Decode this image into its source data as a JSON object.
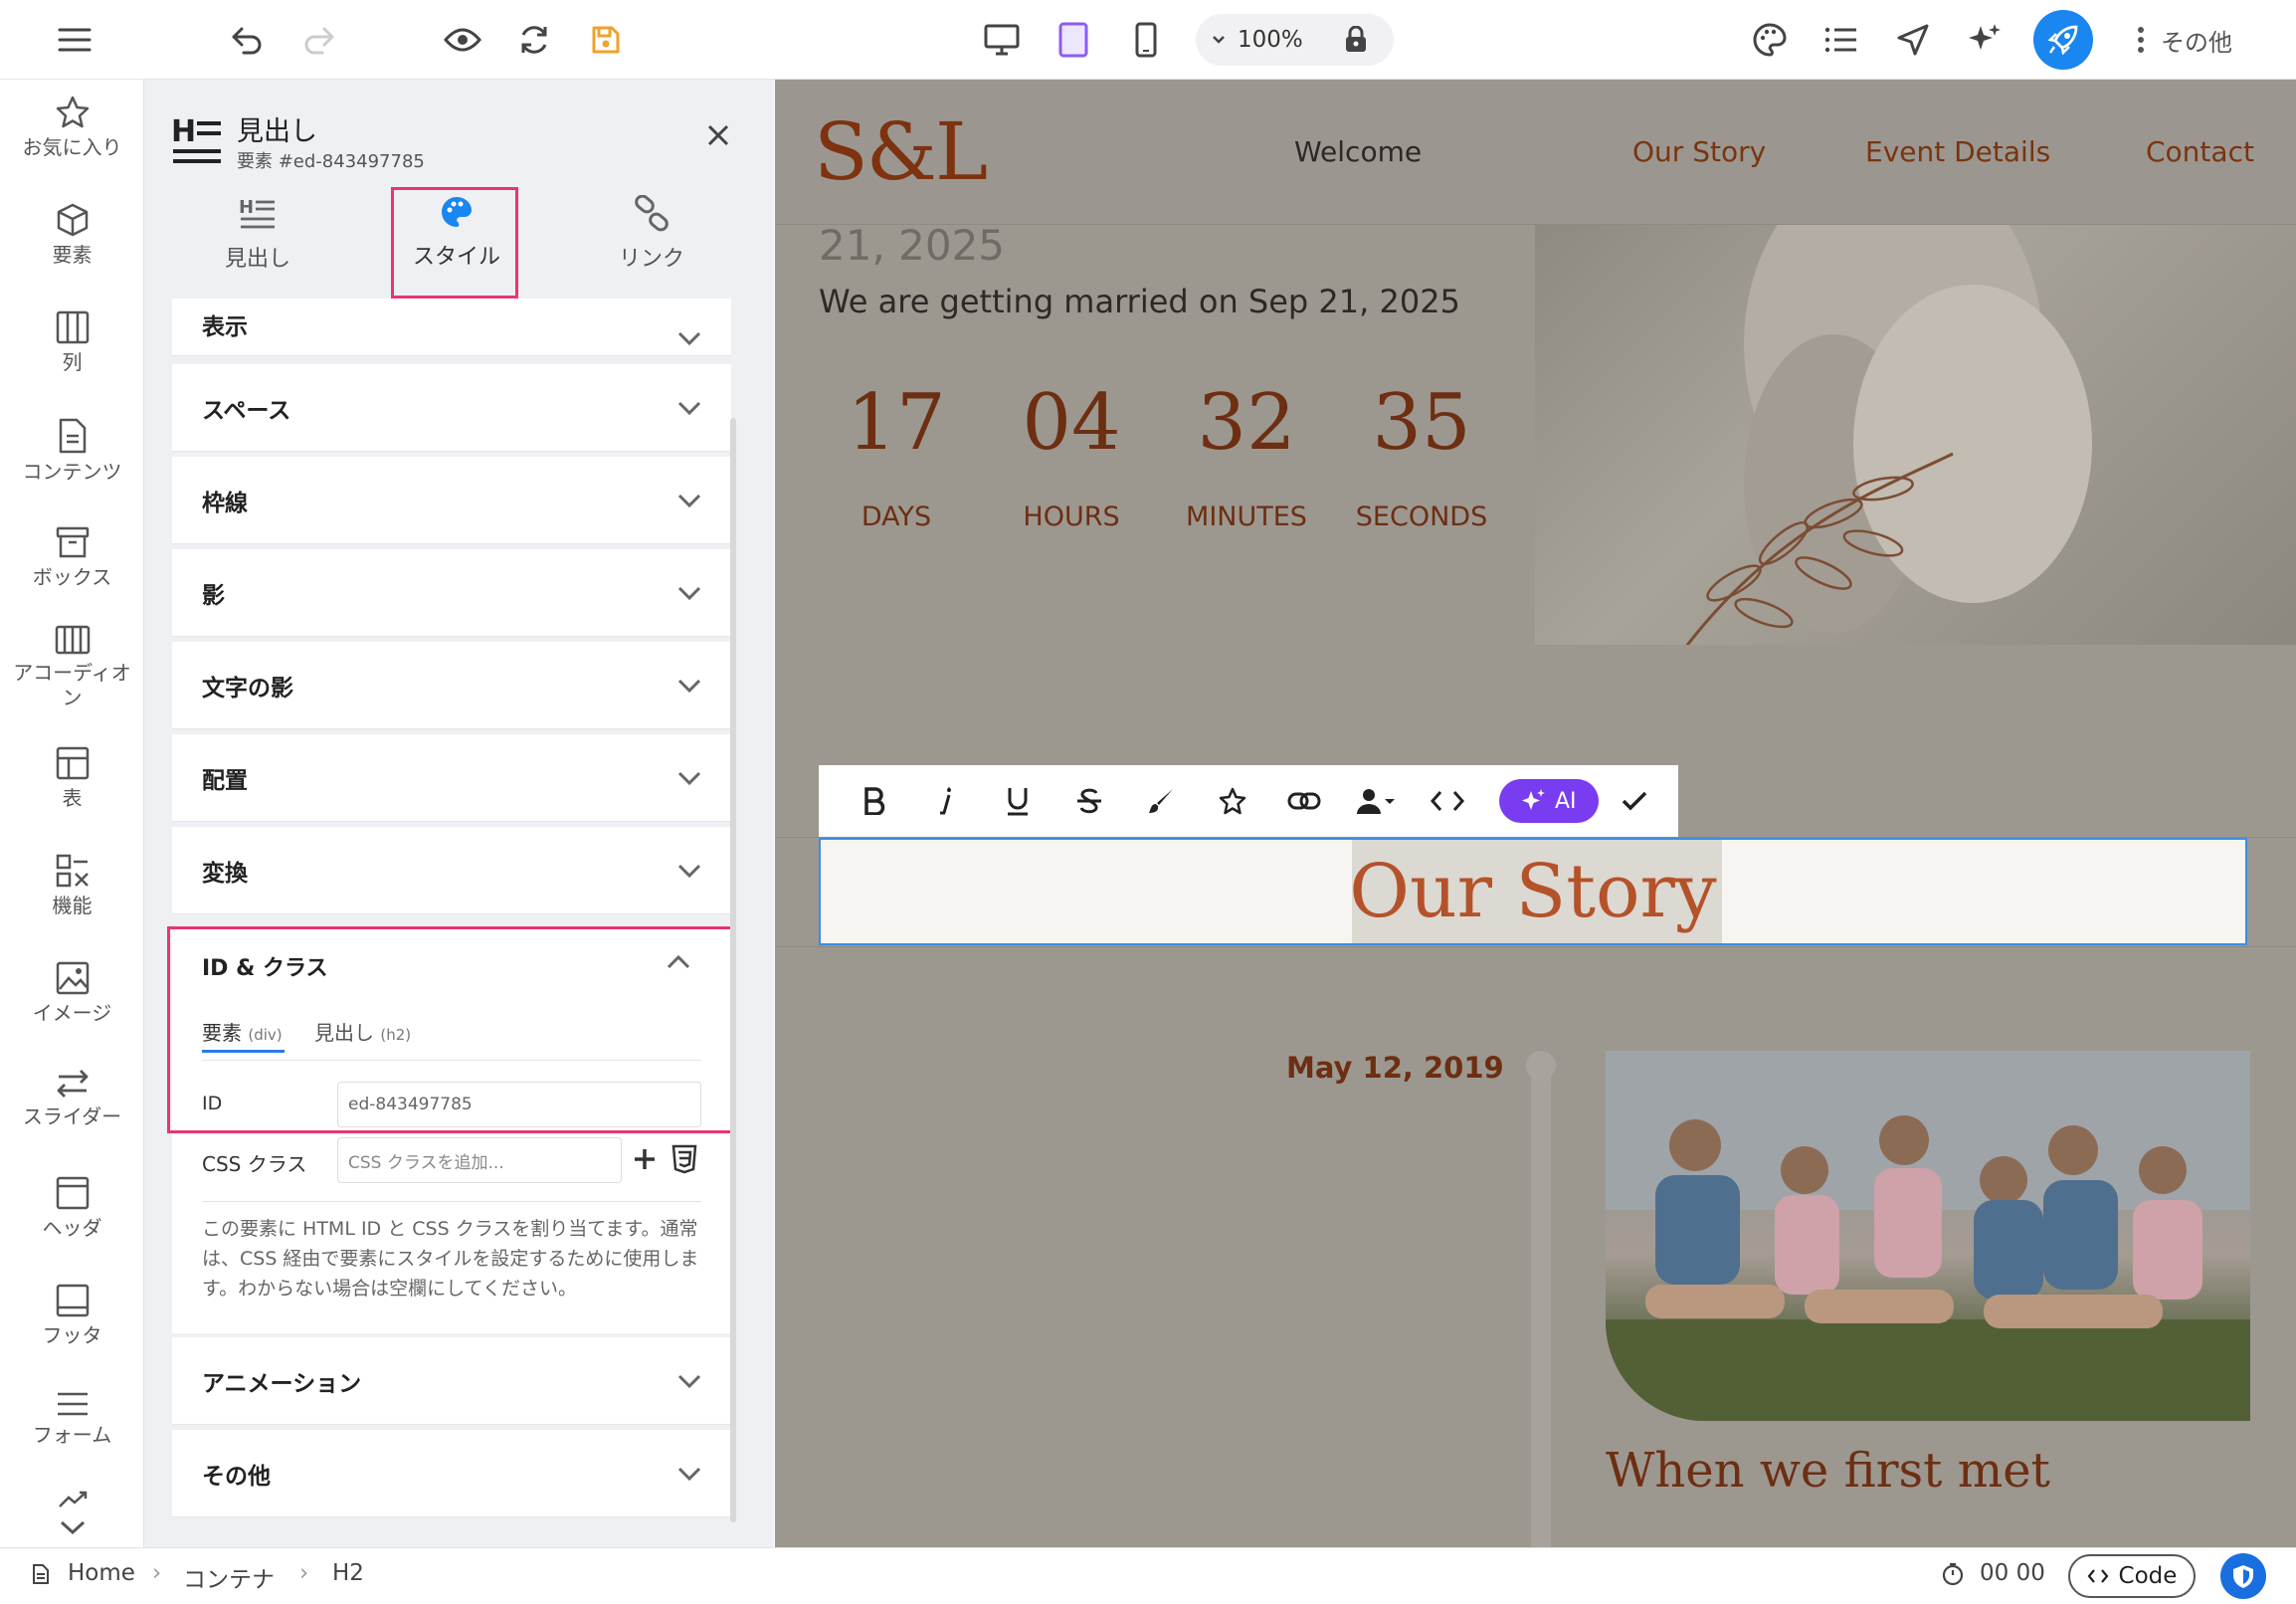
{
  "topbar": {
    "zoom": "100%",
    "more_label": "その他"
  },
  "rail": {
    "items": [
      {
        "label": "お気に入り"
      },
      {
        "label": "要素"
      },
      {
        "label": "列"
      },
      {
        "label": "コンテンツ"
      },
      {
        "label": "ボックス"
      },
      {
        "label": "アコーディオン"
      },
      {
        "label": "表"
      },
      {
        "label": "機能"
      },
      {
        "label": "イメージ"
      },
      {
        "label": "スライダー"
      },
      {
        "label": "ヘッダ"
      },
      {
        "label": "フッタ"
      },
      {
        "label": "フォーム"
      }
    ]
  },
  "panel": {
    "title": "見出し",
    "subtitle": "要素 #ed-843497785",
    "tabs": [
      {
        "label": "見出し"
      },
      {
        "label": "スタイル"
      },
      {
        "label": "リンク"
      }
    ],
    "sections": [
      {
        "label": "表示"
      },
      {
        "label": "スペース"
      },
      {
        "label": "枠線"
      },
      {
        "label": "影"
      },
      {
        "label": "文字の影"
      },
      {
        "label": "配置"
      },
      {
        "label": "変換"
      }
    ],
    "id_class": {
      "title": "ID & クラス",
      "subtab_element": "要素",
      "subtab_element_tag": "(div)",
      "subtab_heading": "見出し",
      "subtab_heading_tag": "(h2)",
      "id_label": "ID",
      "id_value": "ed-843497785",
      "css_label": "CSS クラス",
      "css_placeholder": "CSS クラスを追加...",
      "help": "この要素に HTML ID と CSS クラスを割り当てます。通常は、CSS 経由で要素にスタイルを設定するために使用します。わからない場合は空欄にしてください。"
    },
    "sections_after": [
      {
        "label": "アニメーション"
      },
      {
        "label": "その他"
      }
    ]
  },
  "site": {
    "logo": "S&L",
    "nav": [
      {
        "label": "Welcome"
      },
      {
        "label": "Our Story"
      },
      {
        "label": "Event Details"
      },
      {
        "label": "Contact"
      }
    ],
    "date_fragment": "21, 2025",
    "married_text": "We are getting married on Sep 21, 2025",
    "countdown": [
      {
        "value": "17",
        "label": "DAYS"
      },
      {
        "value": "04",
        "label": "HOURS"
      },
      {
        "value": "32",
        "label": "MINUTES"
      },
      {
        "value": "35",
        "label": "SECONDS"
      }
    ],
    "heading": "Our Story",
    "timeline_date": "May 12, 2019",
    "first_met": "When we first met"
  },
  "editor_toolbar": {
    "ai_label": "AI"
  },
  "bottombar": {
    "breadcrumb": [
      "Home",
      "コンテナ",
      "H2"
    ],
    "timer": "00 00",
    "code_label": "Code"
  },
  "colors": {
    "accent": "#1a86f0",
    "highlight": "#e8356e",
    "ai": "#7a3cf0",
    "heading": "#b4522a"
  }
}
